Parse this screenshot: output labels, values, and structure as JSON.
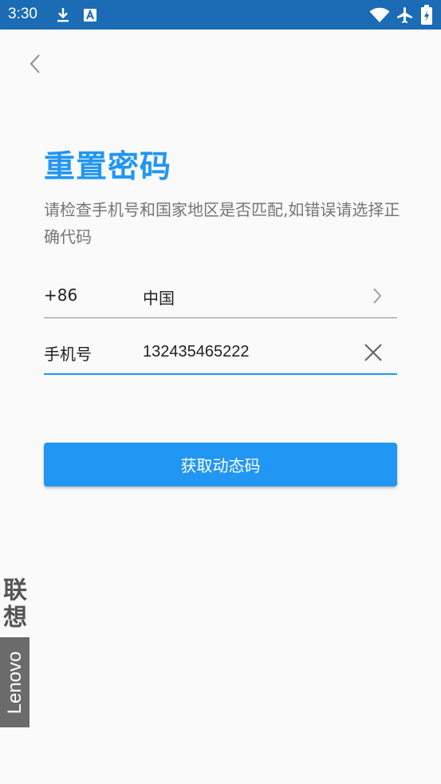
{
  "status_bar": {
    "time": "3:30",
    "icons": [
      "download-icon",
      "a-badge-icon",
      "wifi-icon",
      "airplane-icon",
      "battery-icon"
    ],
    "background": "#1b6bb5"
  },
  "header": {
    "back_icon": "chevron-left-icon"
  },
  "page": {
    "title": "重置密码",
    "subtitle": "请检查手机号和国家地区是否匹配,如错误请选择正确代码",
    "accent_color": "#2196f3"
  },
  "form": {
    "region": {
      "code": "+86",
      "name": "中国",
      "chevron_icon": "chevron-right-icon"
    },
    "phone": {
      "label": "手机号",
      "value": "132435465222",
      "clear_icon": "close-icon"
    },
    "submit_label": "获取动态码"
  },
  "brand": {
    "chinese": "联想",
    "english": "Lenovo"
  }
}
